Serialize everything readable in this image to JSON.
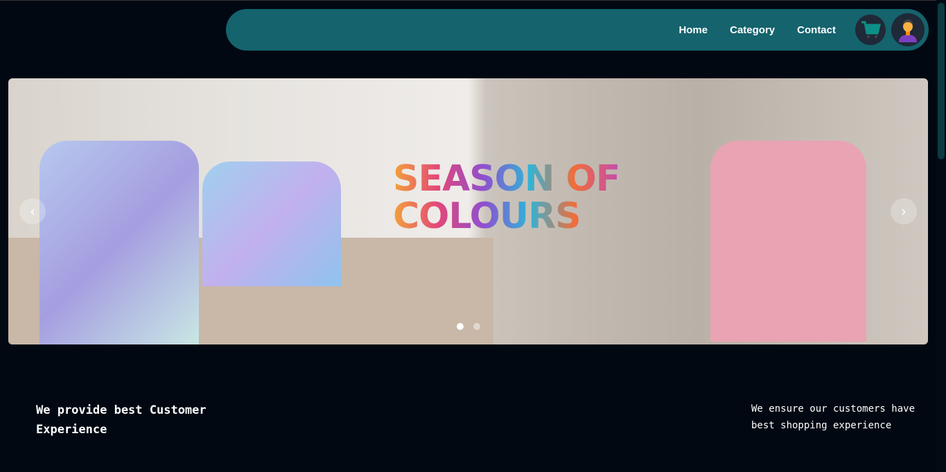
{
  "nav": {
    "items": [
      {
        "label": "Home"
      },
      {
        "label": "Category"
      },
      {
        "label": "Contact"
      }
    ],
    "cart_icon": "cart-icon",
    "avatar_icon": "user-avatar-icon"
  },
  "hero": {
    "banner_text": [
      "SEASON OF",
      "COLOURS"
    ],
    "active_slide": 1,
    "slide_count": 2,
    "prev_icon": "chevron-left-icon",
    "next_icon": "chevron-right-icon"
  },
  "features": {
    "heading": "We provide best Customer Experience",
    "description": "We ensure our customers have best shopping experience"
  },
  "colors": {
    "nav_bg": "#14636d",
    "page_bg": "#010812",
    "cart": "#0d8f86"
  }
}
